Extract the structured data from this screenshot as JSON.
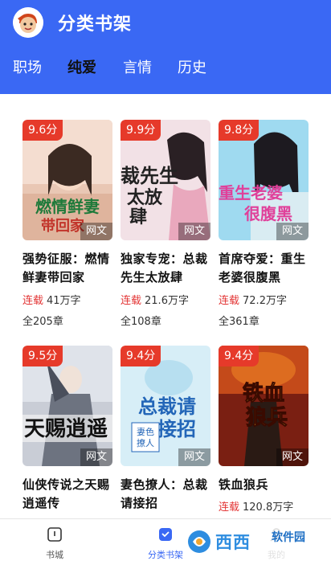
{
  "app": {
    "title": "分类书架",
    "logo_icon": "mascot-avatar-icon"
  },
  "tabs": [
    {
      "label": "职场",
      "active": false
    },
    {
      "label": "纯爱",
      "active": true
    },
    {
      "label": "言情",
      "active": false
    },
    {
      "label": "历史",
      "active": false
    }
  ],
  "books": [
    {
      "score": "9.6分",
      "tag": "网文",
      "title": "强势征服：燃情鲜妻带回家",
      "status": "连载",
      "words": "41万字",
      "chapters": "全205章",
      "cover_color": "#e9c7b4",
      "cover_text": "燃情鲜妻"
    },
    {
      "score": "9.9分",
      "tag": "网文",
      "title": "独家专宠：总裁先生太放肆",
      "status": "连载",
      "words": "21.6万字",
      "chapters": "全108章",
      "cover_color": "#f2e1e6",
      "cover_text": "总裁先生太放肆"
    },
    {
      "score": "9.8分",
      "tag": "网文",
      "title": "首席夺爱：重生老婆很腹黑",
      "status": "连载",
      "words": "72.2万字",
      "chapters": "全361章",
      "cover_color": "#9fdaf0",
      "cover_text": "重生老婆很腹黑"
    },
    {
      "score": "9.5分",
      "tag": "网文",
      "title": "仙侠传说之天赐逍遥传",
      "status": "",
      "words": "",
      "chapters": "",
      "cover_color": "#c9cdd6",
      "cover_text": "天赐逍遥"
    },
    {
      "score": "9.4分",
      "tag": "网文",
      "title": "妻色撩人：总裁请接招",
      "status": "",
      "words": "",
      "chapters": "",
      "cover_color": "#d7eef7",
      "cover_text": "总裁请接招"
    },
    {
      "score": "9.4分",
      "tag": "网文",
      "title": "铁血狼兵",
      "status": "连载",
      "words": "120.8万字",
      "chapters": "",
      "cover_color": "#7a1f12",
      "cover_text": "铁血狼兵"
    }
  ],
  "bottom_nav": [
    {
      "label": "书城",
      "icon": "book-city-icon",
      "active": false
    },
    {
      "label": "分类书架",
      "icon": "bookshelf-icon",
      "active": true
    },
    {
      "label": "我的",
      "icon": "profile-icon",
      "active": false
    }
  ],
  "watermark": {
    "text": "西西",
    "sub": "软件园",
    "color": "#2e8de0"
  },
  "colors": {
    "primary": "#3a68f4",
    "score_badge": "#e63a2a",
    "status_red": "#e33535"
  }
}
